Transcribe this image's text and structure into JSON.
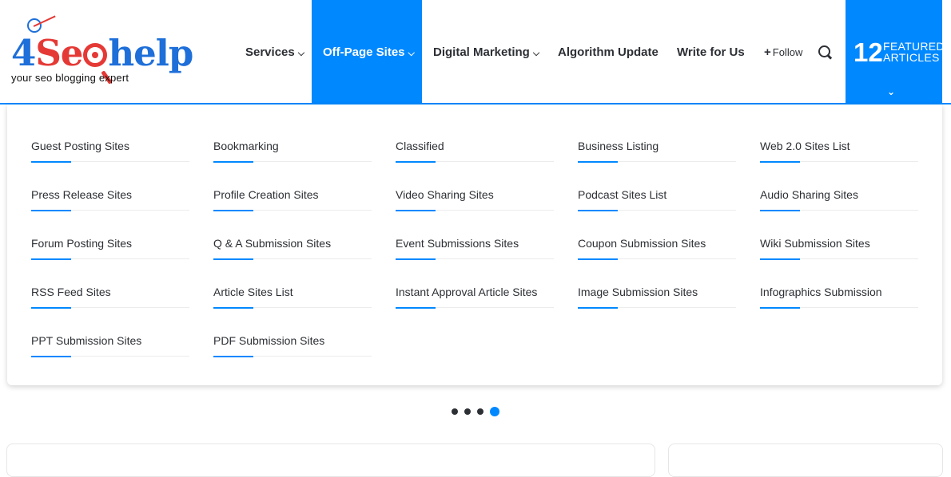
{
  "logo": {
    "number": "4",
    "word_se": "Se",
    "word_help": "help",
    "tagline": "your seo blogging expert"
  },
  "nav": {
    "items": [
      {
        "label": "Services",
        "has_dropdown": true,
        "active": false
      },
      {
        "label": "Off-Page Sites",
        "has_dropdown": true,
        "active": true
      },
      {
        "label": "Digital Marketing",
        "has_dropdown": true,
        "active": false
      },
      {
        "label": "Algorithm Update",
        "has_dropdown": false,
        "active": false
      },
      {
        "label": "Write for Us",
        "has_dropdown": false,
        "active": false
      }
    ],
    "follow_label": "Follow",
    "search_icon": "search-icon"
  },
  "featured": {
    "count": "12",
    "label_line1": "FEATURED",
    "label_line2": "ARTICLES"
  },
  "mega_menu": {
    "columns": [
      [
        "Guest Posting Sites",
        "Press Release Sites",
        "Forum Posting Sites",
        "RSS Feed Sites",
        "PPT Submission Sites"
      ],
      [
        "Bookmarking",
        "Profile Creation Sites",
        "Q & A Submission Sites",
        "Article Sites List",
        "PDF Submission Sites"
      ],
      [
        "Classified",
        "Video Sharing Sites",
        "Event Submissions Sites",
        "Instant Approval Article Sites"
      ],
      [
        "Business Listing",
        "Podcast Sites List",
        "Coupon Submission Sites",
        "Image Submission Sites"
      ],
      [
        "Web 2.0 Sites List",
        "Audio Sharing Sites",
        "Wiki Submission Sites",
        "Infographics Submission"
      ]
    ]
  },
  "slider": {
    "dot_count": 4,
    "active_index": 3
  },
  "colors": {
    "accent": "#0088ff",
    "text": "#2c2f34",
    "logo_blue": "#1e6fd9",
    "logo_red": "#e53935"
  }
}
